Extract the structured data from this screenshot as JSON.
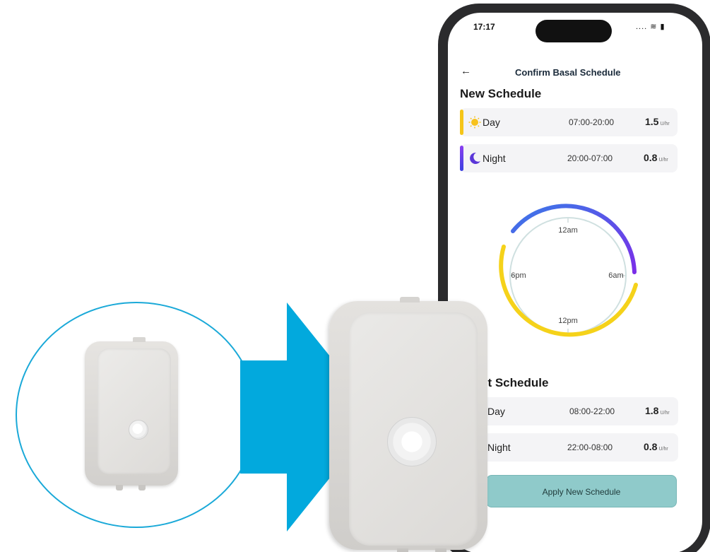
{
  "status_bar": {
    "time": "17:17",
    "icons": ".... ≋ ▮"
  },
  "header": {
    "title": "Confirm Basal Schedule"
  },
  "new_schedule": {
    "title": "New Schedule",
    "rows": [
      {
        "label": "Day",
        "time": "07:00-20:00",
        "value": "1.5",
        "unit": "U/hr",
        "color": "#f5c518",
        "icon": "sun-icon"
      },
      {
        "label": "Night",
        "time": "20:00-07:00",
        "value": "0.8",
        "unit": "U/hr",
        "color": "#6a3ae0",
        "icon": "moon-icon"
      }
    ]
  },
  "clock": {
    "labels": {
      "top": "12am",
      "right": "6am",
      "bottom": "12pm",
      "left": "6pm"
    },
    "day_color": "#f5d21a",
    "night_color": "#6a3ae0"
  },
  "current_schedule": {
    "title": "Current Schedule",
    "title_visible": "rent Schedule",
    "rows": [
      {
        "label": "Day",
        "time": "08:00-22:00",
        "value": "1.8",
        "unit": "U/hr"
      },
      {
        "label": "Night",
        "time": "22:00-08:00",
        "value": "0.8",
        "unit": "U/hr"
      }
    ]
  },
  "apply_button": {
    "label": "Apply New Schedule"
  },
  "colors": {
    "arrow": "#02a9dd",
    "circle": "#1aa9d8",
    "button": "#8fcaca"
  }
}
